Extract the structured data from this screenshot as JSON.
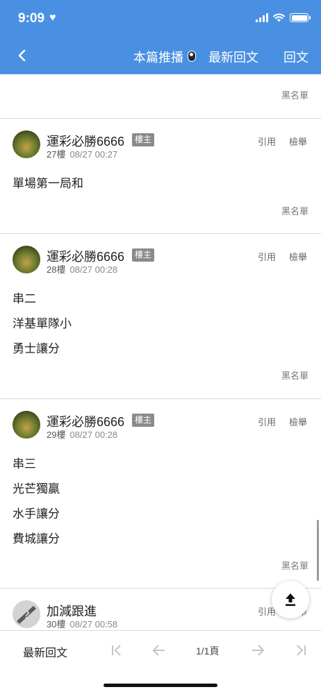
{
  "status_bar": {
    "time": "9:09",
    "heart": "♥"
  },
  "nav": {
    "push_label": "本篇推播",
    "latest_label": "最新回文",
    "reply_label": "回文"
  },
  "labels": {
    "blacklist": "黑名單",
    "quote": "引用",
    "report": "檢舉",
    "op_badge": "樓主"
  },
  "posts": [
    {
      "author": "運彩必勝6666",
      "floor": "27樓",
      "date": "08/27 00:27",
      "lines": [
        "單場第一局和"
      ]
    },
    {
      "author": "運彩必勝6666",
      "floor": "28樓",
      "date": "08/27 00:28",
      "lines": [
        "串二",
        "洋基單隊小",
        "勇士讓分"
      ]
    },
    {
      "author": "運彩必勝6666",
      "floor": "29樓",
      "date": "08/27 00:28",
      "lines": [
        "串三",
        "光芒獨贏",
        "水手讓分",
        "費城讓分"
      ]
    },
    {
      "author": "加減跟進",
      "floor": "30樓",
      "date": "08/27 00:58",
      "lines": []
    }
  ],
  "bottom_bar": {
    "latest_label": "最新回文",
    "page_indicator": "1/1頁"
  }
}
